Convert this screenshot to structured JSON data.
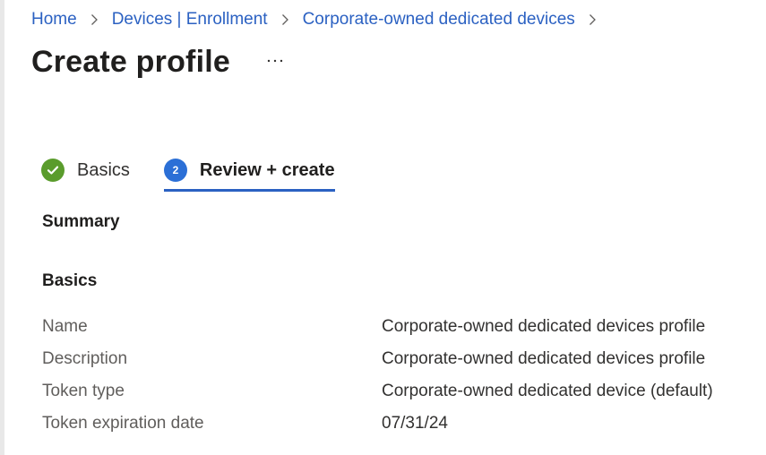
{
  "breadcrumb": {
    "items": [
      "Home",
      "Devices | Enrollment",
      "Corporate-owned dedicated devices"
    ]
  },
  "page": {
    "title": "Create profile",
    "more_label": "···"
  },
  "tabs": [
    {
      "label": "Basics",
      "state": "completed",
      "icon": "checkmark-icon"
    },
    {
      "label": "Review + create",
      "state": "active",
      "step_number": "2"
    }
  ],
  "summary": {
    "heading": "Summary",
    "section_heading": "Basics",
    "rows": [
      {
        "label": "Name",
        "value": "Corporate-owned dedicated devices profile"
      },
      {
        "label": "Description",
        "value": "Corporate-owned dedicated devices profile"
      },
      {
        "label": "Token type",
        "value": "Corporate-owned dedicated device (default)"
      },
      {
        "label": "Token expiration date",
        "value": "07/31/24"
      }
    ]
  },
  "colors": {
    "link": "#2b61c2",
    "success": "#5a9c2c",
    "step_active": "#2b6fd6",
    "tab_underline": "#2b61c2"
  }
}
